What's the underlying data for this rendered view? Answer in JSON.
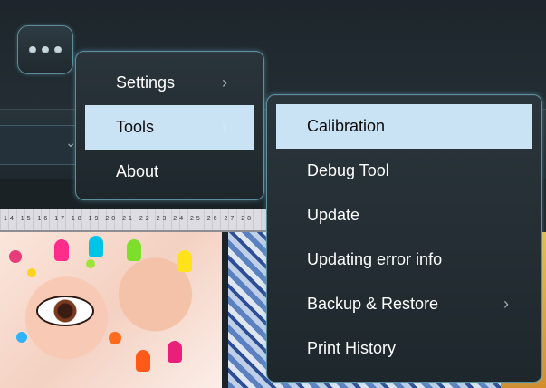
{
  "more_button": {
    "icon": "more-dots-icon"
  },
  "main_menu": {
    "items": [
      {
        "label": "Settings",
        "has_submenu": true,
        "arrow": "›"
      },
      {
        "label": "Tools",
        "has_submenu": true,
        "arrow": "›",
        "active": true
      },
      {
        "label": "About",
        "has_submenu": false
      }
    ]
  },
  "tools_submenu": {
    "items": [
      {
        "label": "Calibration",
        "active": true
      },
      {
        "label": "Debug Tool"
      },
      {
        "label": "Update"
      },
      {
        "label": "Updating error info"
      },
      {
        "label": "Backup & Restore",
        "has_submenu": true,
        "arrow": "›"
      },
      {
        "label": "Print History"
      }
    ]
  },
  "background": {
    "dropdown_chevron": "⌄",
    "ruler_labels": "14 15 16 17 18 19 20 21 22 23 24 25 26 27 28"
  },
  "colors": {
    "menu_bg": "#232d33",
    "menu_border": "#5c8e9c",
    "highlight": "#c9e3f4",
    "text": "#ffffff"
  }
}
